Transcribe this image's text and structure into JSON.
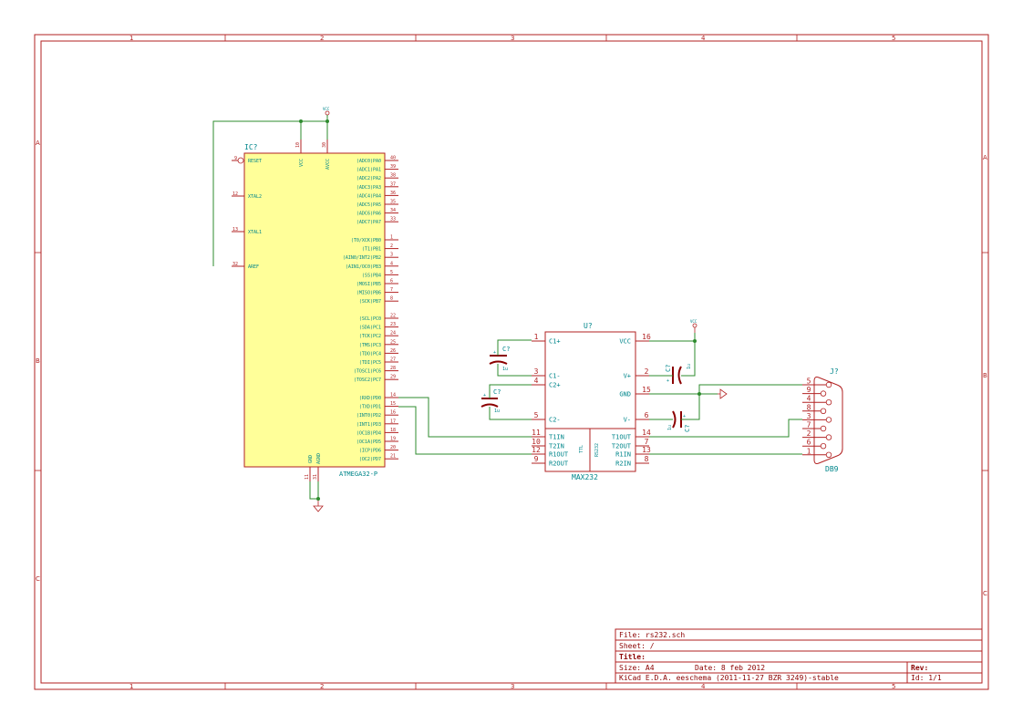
{
  "frame": {
    "columns": [
      "1",
      "2",
      "3",
      "4",
      "5"
    ],
    "rows": [
      "A",
      "B",
      "C"
    ]
  },
  "ic": {
    "ref": "IC?",
    "value": "ATMEGA32-P",
    "left_pins": [
      {
        "num": "9",
        "name": "RESET"
      },
      {
        "num": "12",
        "name": "XTAL2"
      },
      {
        "num": "13",
        "name": "XTAL1"
      },
      {
        "num": "32",
        "name": "AREF"
      }
    ],
    "top_pins": [
      {
        "num": "10",
        "name": "VCC"
      },
      {
        "num": "30",
        "name": "AVCC"
      }
    ],
    "bottom_pins": [
      {
        "num": "11",
        "name": "GND"
      },
      {
        "num": "31",
        "name": "AGND"
      }
    ],
    "right_pins": [
      {
        "num": "40",
        "name": "(ADC0)PA0"
      },
      {
        "num": "39",
        "name": "(ADC1)PA1"
      },
      {
        "num": "38",
        "name": "(ADC2)PA2"
      },
      {
        "num": "37",
        "name": "(ADC3)PA3"
      },
      {
        "num": "36",
        "name": "(ADC4)PA4"
      },
      {
        "num": "35",
        "name": "(ADC5)PA5"
      },
      {
        "num": "34",
        "name": "(ADC6)PA6"
      },
      {
        "num": "33",
        "name": "(ADC7)PA7"
      },
      {
        "num": "1",
        "name": "(T0/XCK)PB0"
      },
      {
        "num": "2",
        "name": "(T1)PB1"
      },
      {
        "num": "3",
        "name": "(AIN0/INT2)PB2"
      },
      {
        "num": "4",
        "name": "(AIN1/OC0)PB3"
      },
      {
        "num": "5",
        "name": "(SS)PB4"
      },
      {
        "num": "6",
        "name": "(MOSI)PB5"
      },
      {
        "num": "7",
        "name": "(MISO)PB6"
      },
      {
        "num": "8",
        "name": "(SCK)PB7"
      },
      {
        "num": "22",
        "name": "(SCL)PC0"
      },
      {
        "num": "23",
        "name": "(SDA)PC1"
      },
      {
        "num": "24",
        "name": "(TCK)PC2"
      },
      {
        "num": "25",
        "name": "(TMS)PC3"
      },
      {
        "num": "26",
        "name": "(TDO)PC4"
      },
      {
        "num": "27",
        "name": "(TDI)PC5"
      },
      {
        "num": "28",
        "name": "(TOSC1)PC6"
      },
      {
        "num": "29",
        "name": "(TOSC2)PC7"
      },
      {
        "num": "14",
        "name": "(RXD)PD0"
      },
      {
        "num": "15",
        "name": "(TXD)PD1"
      },
      {
        "num": "16",
        "name": "(INT0)PD2"
      },
      {
        "num": "17",
        "name": "(INT1)PD3"
      },
      {
        "num": "18",
        "name": "(OC1B)PD4"
      },
      {
        "num": "19",
        "name": "(OC1A)PD5"
      },
      {
        "num": "20",
        "name": "(ICP)PD6"
      },
      {
        "num": "21",
        "name": "(OC2)PD7"
      }
    ]
  },
  "max": {
    "ref": "U?",
    "value": "MAX232",
    "ttl_label": "TTL",
    "rs232_label": "RS232",
    "left_pins": [
      {
        "num": "1",
        "name": "C1+"
      },
      {
        "num": "3",
        "name": "C1-"
      },
      {
        "num": "4",
        "name": "C2+"
      },
      {
        "num": "5",
        "name": "C2-"
      },
      {
        "num": "11",
        "name": "T1IN"
      },
      {
        "num": "10",
        "name": "T2IN"
      },
      {
        "num": "12",
        "name": "R1OUT"
      },
      {
        "num": "9",
        "name": "R2OUT"
      }
    ],
    "right_pins": [
      {
        "num": "16",
        "name": "VCC"
      },
      {
        "num": "2",
        "name": "V+"
      },
      {
        "num": "15",
        "name": "GND"
      },
      {
        "num": "6",
        "name": "V-"
      },
      {
        "num": "14",
        "name": "T1OUT"
      },
      {
        "num": "7",
        "name": "T2OUT"
      },
      {
        "num": "13",
        "name": "R1IN"
      },
      {
        "num": "8",
        "name": "R2IN"
      }
    ]
  },
  "db9": {
    "ref": "J?",
    "value": "DB9",
    "pins": [
      "5",
      "9",
      "4",
      "8",
      "3",
      "7",
      "2",
      "6",
      "1"
    ]
  },
  "caps": [
    {
      "ref": "C?",
      "value": "1u"
    },
    {
      "ref": "C?",
      "value": "1u"
    },
    {
      "ref": "C?",
      "value": "1u"
    },
    {
      "ref": "C?",
      "value": "1u"
    }
  ],
  "power": {
    "vcc_label": "VCC",
    "gnd_label": "GND"
  },
  "title_block": {
    "file": "File: rs232.sch",
    "sheet": "Sheet: /",
    "title": "Title:",
    "size": "Size: A4",
    "date": "Date: 8 feb 2012",
    "rev": "Rev:",
    "app": "KiCad E.D.A.  eeschema (2011-11-27 BZR 3249)-stable",
    "id": "Id: 1/1"
  }
}
